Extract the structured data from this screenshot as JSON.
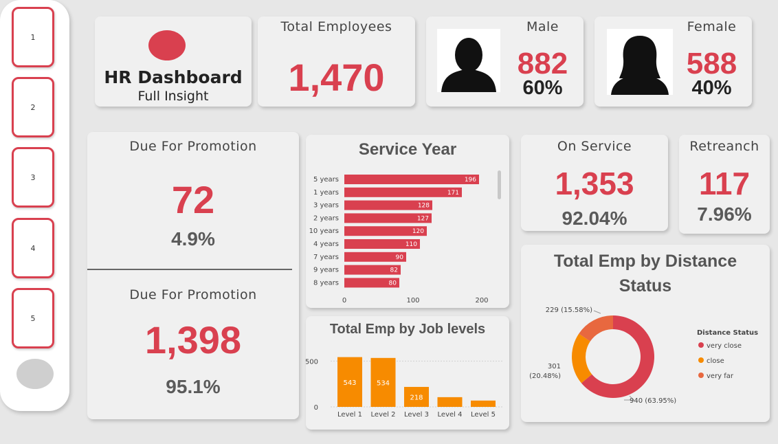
{
  "sidebar": {
    "items": [
      "1",
      "2",
      "3",
      "4",
      "5"
    ]
  },
  "header": {
    "title": "HR Dashboard",
    "subtitle": "Full Insight"
  },
  "kpi": {
    "total": {
      "label": "Total Employees",
      "value": "1,470"
    },
    "male": {
      "label": "Male",
      "value": "882",
      "pct": "60%"
    },
    "female": {
      "label": "Female",
      "value": "588",
      "pct": "40%"
    },
    "promo_due": {
      "label": "Due For Promotion",
      "value": "72",
      "pct": "4.9%"
    },
    "promo_not": {
      "label": "Due For Promotion",
      "value": "1,398",
      "pct": "95.1%"
    },
    "on_service": {
      "label": "On Service",
      "value": "1,353",
      "pct": "92.04%"
    },
    "retreanch": {
      "label": "Retreanch",
      "value": "117",
      "pct": "7.96%"
    }
  },
  "colors": {
    "accent": "#d9404f",
    "orange": "#f78b00",
    "coral": "#e8683f"
  },
  "chart_data": [
    {
      "type": "bar",
      "orientation": "horizontal",
      "title": "Service Year",
      "categories": [
        "5 years",
        "1 years",
        "3 years",
        "2 years",
        "10 years",
        "4 years",
        "7 years",
        "9 years",
        "8 years"
      ],
      "values": [
        196,
        171,
        128,
        127,
        120,
        110,
        90,
        82,
        80
      ],
      "xticks": [
        "0",
        "100",
        "200"
      ],
      "xlim": [
        0,
        230
      ],
      "color": "#d9404f"
    },
    {
      "type": "bar",
      "title": "Total Emp by Job levels",
      "categories": [
        "Level 1",
        "Level 2",
        "Level 3",
        "Level 4",
        "Level 5"
      ],
      "values": [
        543,
        534,
        218,
        106,
        69
      ],
      "value_labels": [
        "543",
        "534",
        "218",
        "",
        ""
      ],
      "yticks": [
        "0",
        "500"
      ],
      "ylim": [
        0,
        600
      ],
      "color": "#f78b00"
    },
    {
      "type": "pie",
      "donut": true,
      "title": "Total Emp by Distance Status",
      "legend_title": "Distance Status",
      "legend": "right",
      "slices": [
        {
          "name": "very close",
          "value": 940,
          "label": "940 (63.95%)",
          "color": "#d9404f"
        },
        {
          "name": "close",
          "value": 301,
          "label_line1": "301",
          "label_line2": "(20.48%)",
          "color": "#f78b00"
        },
        {
          "name": "very far",
          "value": 229,
          "label": "229 (15.58%)",
          "color": "#e8683f"
        }
      ]
    }
  ]
}
